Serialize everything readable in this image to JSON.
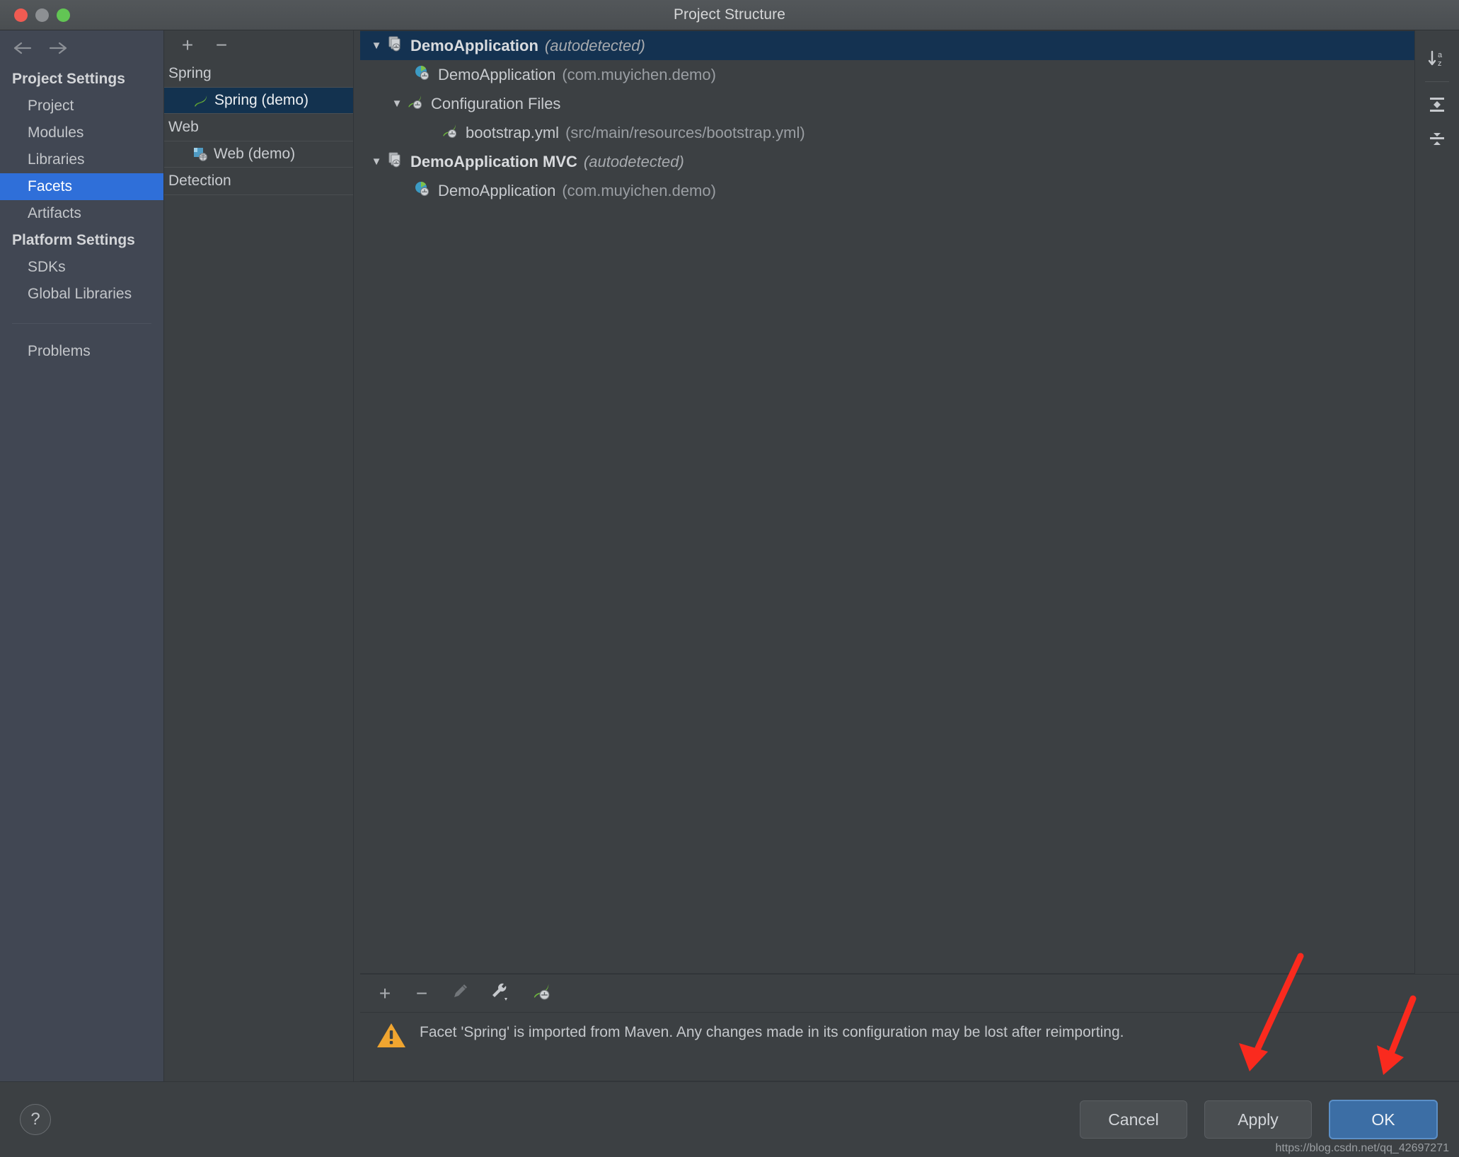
{
  "window": {
    "title": "Project Structure",
    "traffic_lights": [
      "close",
      "minimize",
      "maximize"
    ]
  },
  "sidebar": {
    "back_icon": "arrow-left-icon",
    "forward_icon": "arrow-right-icon",
    "groups": [
      {
        "title": "Project Settings",
        "items": [
          {
            "label": "Project",
            "selected": false
          },
          {
            "label": "Modules",
            "selected": false
          },
          {
            "label": "Libraries",
            "selected": false
          },
          {
            "label": "Facets",
            "selected": true
          },
          {
            "label": "Artifacts",
            "selected": false
          }
        ]
      },
      {
        "title": "Platform Settings",
        "items": [
          {
            "label": "SDKs",
            "selected": false
          },
          {
            "label": "Global Libraries",
            "selected": false
          }
        ]
      }
    ],
    "extra_items": [
      {
        "label": "Problems",
        "selected": false
      }
    ]
  },
  "facet_panel": {
    "toolbar": {
      "add_label": "+",
      "remove_label": "−",
      "add_icon": "plus-icon",
      "remove_icon": "minus-icon"
    },
    "groups": [
      {
        "label": "Spring",
        "items": [
          {
            "label": "Spring (demo)",
            "icon": "spring-leaf-icon",
            "selected": true
          }
        ]
      },
      {
        "label": "Web",
        "items": [
          {
            "label": "Web (demo)",
            "icon": "web-facet-icon",
            "selected": false
          }
        ]
      },
      {
        "label": "Detection",
        "items": []
      }
    ]
  },
  "tree": {
    "rows": [
      {
        "indent": 0,
        "twisty": "▼",
        "icon": "spring-context-icon",
        "label": "DemoApplication",
        "label_bold": true,
        "suffix": "(autodetected)",
        "suffix_style": "italic",
        "selected": true
      },
      {
        "indent": 1,
        "twisty": "",
        "icon": "spring-bean-class-icon",
        "label": "DemoApplication",
        "label_bold": false,
        "suffix": "(com.muyichen.demo)",
        "suffix_style": "dim",
        "selected": false
      },
      {
        "indent": 1,
        "twisty": "▼",
        "icon": "spring-config-icon",
        "label": "Configuration Files",
        "label_bold": false,
        "suffix": "",
        "suffix_style": "dim",
        "selected": false
      },
      {
        "indent": 2,
        "twisty": "",
        "icon": "spring-config-icon",
        "label": "bootstrap.yml",
        "label_bold": false,
        "suffix": "(src/main/resources/bootstrap.yml)",
        "suffix_style": "dim",
        "selected": false
      },
      {
        "indent": 0,
        "twisty": "▼",
        "icon": "spring-context-icon",
        "label": "DemoApplication MVC",
        "label_bold": true,
        "suffix": "(autodetected)",
        "suffix_style": "italic",
        "selected": false
      },
      {
        "indent": 1,
        "twisty": "",
        "icon": "spring-bean-class-icon",
        "label": "DemoApplication",
        "label_bold": false,
        "suffix": "(com.muyichen.demo)",
        "suffix_style": "dim",
        "selected": false
      }
    ],
    "right_toolbar": [
      {
        "icon": "sort-alphabetically-icon",
        "label": "a z"
      },
      {
        "icon": "expand-all-icon",
        "label": ""
      },
      {
        "icon": "collapse-all-icon",
        "label": ""
      }
    ]
  },
  "detail_toolbar": {
    "buttons": [
      {
        "icon": "plus-icon",
        "label": "+"
      },
      {
        "icon": "minus-icon",
        "label": "−"
      },
      {
        "icon": "edit-pencil-icon",
        "label": ""
      },
      {
        "icon": "wrench-dropdown-icon",
        "label": ""
      },
      {
        "icon": "spring-config-icon",
        "label": ""
      }
    ]
  },
  "warning": {
    "icon": "warning-triangle-icon",
    "text": "Facet 'Spring' is imported from Maven. Any changes made in its configuration may be lost after reimporting."
  },
  "footer": {
    "help_label": "?",
    "help_icon": "help-question-icon",
    "buttons": [
      {
        "label": "Cancel",
        "primary": false
      },
      {
        "label": "Apply",
        "primary": false
      },
      {
        "label": "OK",
        "primary": true
      }
    ],
    "watermark": "https://blog.csdn.net/qq_42697271"
  },
  "annotations": {
    "arrow_color": "#fa2a1e",
    "arrows": [
      {
        "name": "arrow-pointing-to-apply"
      },
      {
        "name": "arrow-pointing-to-ok"
      }
    ]
  },
  "colors": {
    "accent_selection": "#2f6fd9",
    "tree_selection": "#143251",
    "panel_bg": "#3c4043",
    "sidebar_bg": "#414753",
    "primary_button": "#3c6ea5",
    "warning": "#f0a530"
  }
}
